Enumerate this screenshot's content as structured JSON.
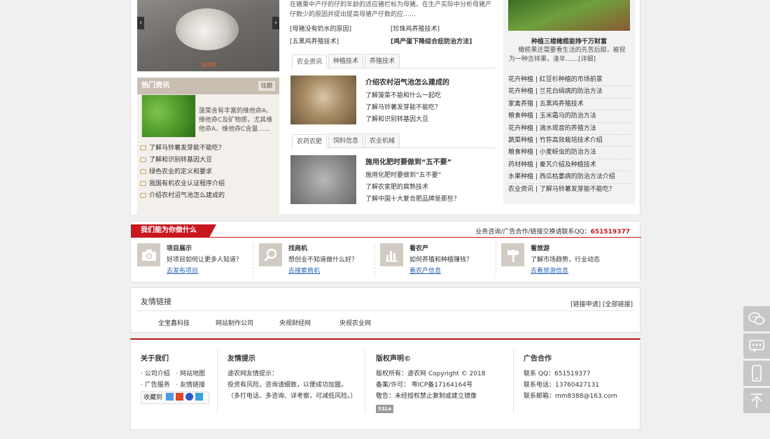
{
  "top": {
    "slider_prev": "‹",
    "slider_next": "›",
    "slider_watermark": "途农网",
    "hot": {
      "title": "热门资讯",
      "more": "往期",
      "desc": "菠菜含有丰富的维他命A、维他命C及矿物质，尤其维他命A、维他命C含量……",
      "items": [
        "了解马铃薯发芽能不能吃？",
        "了解和识别转基因大豆",
        "绿色农业的定义和要求",
        "我国有机农业认证程序介绍",
        "介绍农村沼气池怎么建成的"
      ]
    },
    "article": {
      "text": "在猪栗中产仔的仔的年龄的适应猪栏标为母猪，在生产实际中分析母猪产仔数少的原因并提出提高母猪产仔数的应……",
      "links": [
        "[母猪没有奶水的原因]",
        "[珍珠鸡养殖技术]",
        "[五黑鸡养殖技术]",
        "[鸡产蛋下降综合症防治方法]"
      ]
    },
    "tabs1": [
      "农业资讯",
      "种植技术",
      "养殖技术"
    ],
    "news1": {
      "title": "介绍农村沼气池怎么建成的",
      "items": [
        "了解菠菜不能和什么一起吃",
        "了解马铃薯发芽能不能吃？",
        "了解和识别转基因大豆"
      ]
    },
    "tabs2": [
      "农药农肥",
      "饲料信息",
      "农业机械"
    ],
    "news2": {
      "title": "施用化肥时要做到“五不要”",
      "items": [
        "施用化肥时要做到“五不要”",
        "了解农家肥的腐熟技术",
        "了解中国十大复合肥品牌是那些？"
      ]
    },
    "right": {
      "title": "种植三楼橄榄能挣千万财富",
      "desc": "橄榄果还需要看生活的先苦后甜，被视为一种吉祥果，逢年……[详细]",
      "items": [
        "花卉种植 | 红豆杉种植的市场前景",
        "花卉种植 | 兰花白绢病的防治方法",
        "家禽养殖 | 五黑鸡养殖技术",
        "粮食种植 | 玉米霜马的防治方法",
        "花卉种植 | 滴水观音的养殖方法",
        "蔬菜种植 | 竹荪高效栽培技术介绍",
        "粮食种植 | 小麦蚜虫的防治方法",
        "药材种植 | 秦艽介绍及种植技术",
        "水果种植 | 西瓜枯萎病的防治方法介绍",
        "农业资讯 | 了解马铃薯发芽能不能吃？"
      ]
    }
  },
  "service": {
    "title": "我们能为你做什么",
    "contact_label": "业务咨询/广告合作/链接交换请联系QQ：",
    "contact_qq": "651519377",
    "items": [
      {
        "title": "项目展示",
        "desc": "好项目如何让更多人知道？",
        "link": "去发布项目",
        "icon": "camera-icon"
      },
      {
        "title": "找商机",
        "desc": "想创业不知道做什么好？",
        "link": "去搜索商机",
        "icon": "magnifier-icon"
      },
      {
        "title": "看农产",
        "desc": "如何养殖和种植赚钱？",
        "link": "看农产信息",
        "icon": "bar-chart-icon"
      },
      {
        "title": "看旅游",
        "desc": "了解市场趋势，行业动态",
        "link": "去看旅游信息",
        "icon": "signpost-icon"
      }
    ]
  },
  "friends": {
    "title": "友情链接",
    "apply": "[链接申请]",
    "all": "[全部链接]",
    "links": [
      "全宝鑫科技",
      "网站制作公司",
      "央视财经网",
      "央视农业网"
    ]
  },
  "footer": {
    "about": {
      "title": "关于我们",
      "links": [
        "· 公司介绍",
        "· 网站地图",
        "· 广告服务",
        "· 友情链接"
      ],
      "fav": "收藏到"
    },
    "tips": {
      "title": "友情提示",
      "lines": [
        "途农网友情提示：",
        "投资有风险，咨询请细致，以便成功加盟。",
        "（多打电话、多咨询、详考察，可减低风险。）"
      ]
    },
    "copyright": {
      "title": "版权声明©",
      "lines": [
        "版权所有：途农网 Copyright © 2018",
        "备案/许可： 粤ICP备17164164号",
        "敬告：未经授权禁止复制或建立镜像"
      ],
      "badge": "51La"
    },
    "ads": {
      "title": "广告合作",
      "lines": [
        "联系 QQ：651519377",
        "联系电话：13760427131",
        "联系邮箱：mm8388@163.com"
      ]
    }
  },
  "sidebar": [
    "wechat-icon",
    "message-icon",
    "mobile-icon",
    "back-to-top-icon"
  ]
}
